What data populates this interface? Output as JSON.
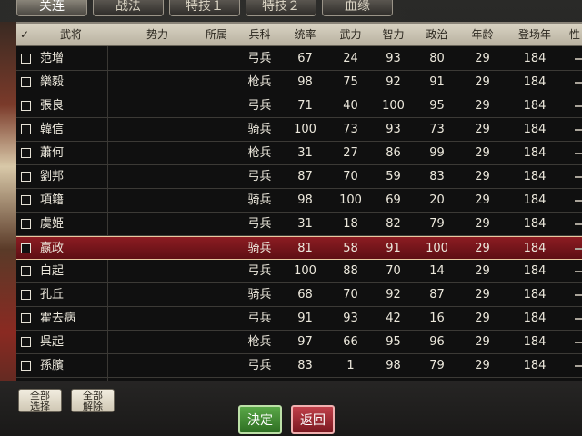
{
  "tabs": [
    "关连",
    "战法",
    "特技１",
    "特技２",
    "血缘"
  ],
  "headers": [
    "✓",
    "武将",
    "势力",
    "所属",
    "兵科",
    "统率",
    "武力",
    "智力",
    "政治",
    "年龄",
    "登场年",
    "性"
  ],
  "rows": [
    {
      "name": "范增",
      "unit": "弓兵",
      "lead": "67",
      "war": "24",
      "int": "93",
      "pol": "80",
      "age": "29",
      "year": "184"
    },
    {
      "name": "樂毅",
      "unit": "枪兵",
      "lead": "98",
      "war": "75",
      "int": "92",
      "pol": "91",
      "age": "29",
      "year": "184"
    },
    {
      "name": "張良",
      "unit": "弓兵",
      "lead": "71",
      "war": "40",
      "int": "100",
      "pol": "95",
      "age": "29",
      "year": "184"
    },
    {
      "name": "韓信",
      "unit": "骑兵",
      "lead": "100",
      "war": "73",
      "int": "93",
      "pol": "73",
      "age": "29",
      "year": "184"
    },
    {
      "name": "蕭何",
      "unit": "枪兵",
      "lead": "31",
      "war": "27",
      "int": "86",
      "pol": "99",
      "age": "29",
      "year": "184"
    },
    {
      "name": "劉邦",
      "unit": "弓兵",
      "lead": "87",
      "war": "70",
      "int": "59",
      "pol": "83",
      "age": "29",
      "year": "184"
    },
    {
      "name": "項籍",
      "unit": "骑兵",
      "lead": "98",
      "war": "100",
      "int": "69",
      "pol": "20",
      "age": "29",
      "year": "184"
    },
    {
      "name": "虞姫",
      "unit": "弓兵",
      "lead": "31",
      "war": "18",
      "int": "82",
      "pol": "79",
      "age": "29",
      "year": "184"
    },
    {
      "name": "嬴政",
      "unit": "骑兵",
      "lead": "81",
      "war": "58",
      "int": "91",
      "pol": "100",
      "age": "29",
      "year": "184"
    },
    {
      "name": "白起",
      "unit": "弓兵",
      "lead": "100",
      "war": "88",
      "int": "70",
      "pol": "14",
      "age": "29",
      "year": "184"
    },
    {
      "name": "孔丘",
      "unit": "骑兵",
      "lead": "68",
      "war": "70",
      "int": "92",
      "pol": "87",
      "age": "29",
      "year": "184"
    },
    {
      "name": "霍去病",
      "unit": "弓兵",
      "lead": "91",
      "war": "93",
      "int": "42",
      "pol": "16",
      "age": "29",
      "year": "184"
    },
    {
      "name": "呉起",
      "unit": "枪兵",
      "lead": "97",
      "war": "66",
      "int": "95",
      "pol": "96",
      "age": "29",
      "year": "184"
    },
    {
      "name": "孫臏",
      "unit": "弓兵",
      "lead": "83",
      "war": "1",
      "int": "98",
      "pol": "79",
      "age": "29",
      "year": "184"
    }
  ],
  "buttons": {
    "select_all_1": "全部",
    "select_all_2": "选择",
    "deselect_all_1": "全部",
    "deselect_all_2": "解除",
    "confirm": "決定",
    "back": "返回"
  },
  "colors": {
    "selected_row": "#8c1c22",
    "confirm_button": "#4a9a3a",
    "back_button": "#a8303a"
  }
}
